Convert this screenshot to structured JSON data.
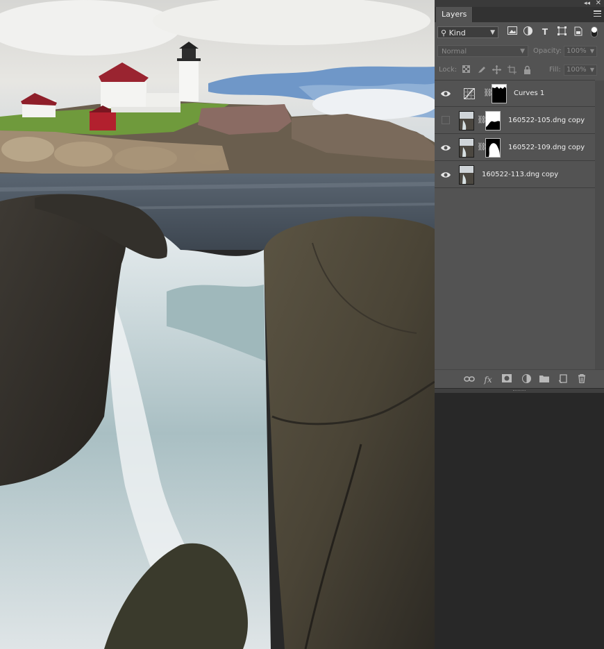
{
  "window": {
    "collapse_glyph": "◂◂",
    "close_glyph": "✕"
  },
  "panel": {
    "tab_label": "Layers",
    "menu_icon": "panel-menu-icon"
  },
  "filter": {
    "search_glyph": "⚲",
    "kind_label": "Kind",
    "icons": [
      "image-filter-icon",
      "adjustment-filter-icon",
      "type-filter-icon",
      "shape-filter-icon",
      "smart-object-filter-icon"
    ],
    "type_glyph": "T"
  },
  "blend": {
    "mode": "Normal",
    "opacity_label": "Opacity:",
    "opacity_value": "100%",
    "fill_label": "Fill:",
    "fill_value": "100%"
  },
  "lock": {
    "label": "Lock:",
    "icons": [
      "lock-transparent-icon",
      "lock-image-icon",
      "lock-position-icon",
      "lock-artboard-icon",
      "lock-all-icon"
    ]
  },
  "layers": [
    {
      "name": "Curves 1",
      "visible": true,
      "type": "adjustment",
      "has_mask": true
    },
    {
      "name": "160522-105.dng copy",
      "visible": false,
      "type": "pixel",
      "has_mask": true
    },
    {
      "name": "160522-109.dng copy",
      "visible": true,
      "type": "pixel",
      "has_mask": true
    },
    {
      "name": "160522-113.dng copy",
      "visible": true,
      "type": "pixel",
      "has_mask": false
    }
  ],
  "footer_icons": [
    "link-layers-icon",
    "fx-icon",
    "add-mask-icon",
    "new-adjustment-icon",
    "new-group-icon",
    "new-layer-icon",
    "delete-layer-icon"
  ],
  "footer_fx": "fx",
  "colors": {
    "panel_bg": "#535353",
    "dark_bg": "#282828",
    "text": "#f0f0f0"
  }
}
